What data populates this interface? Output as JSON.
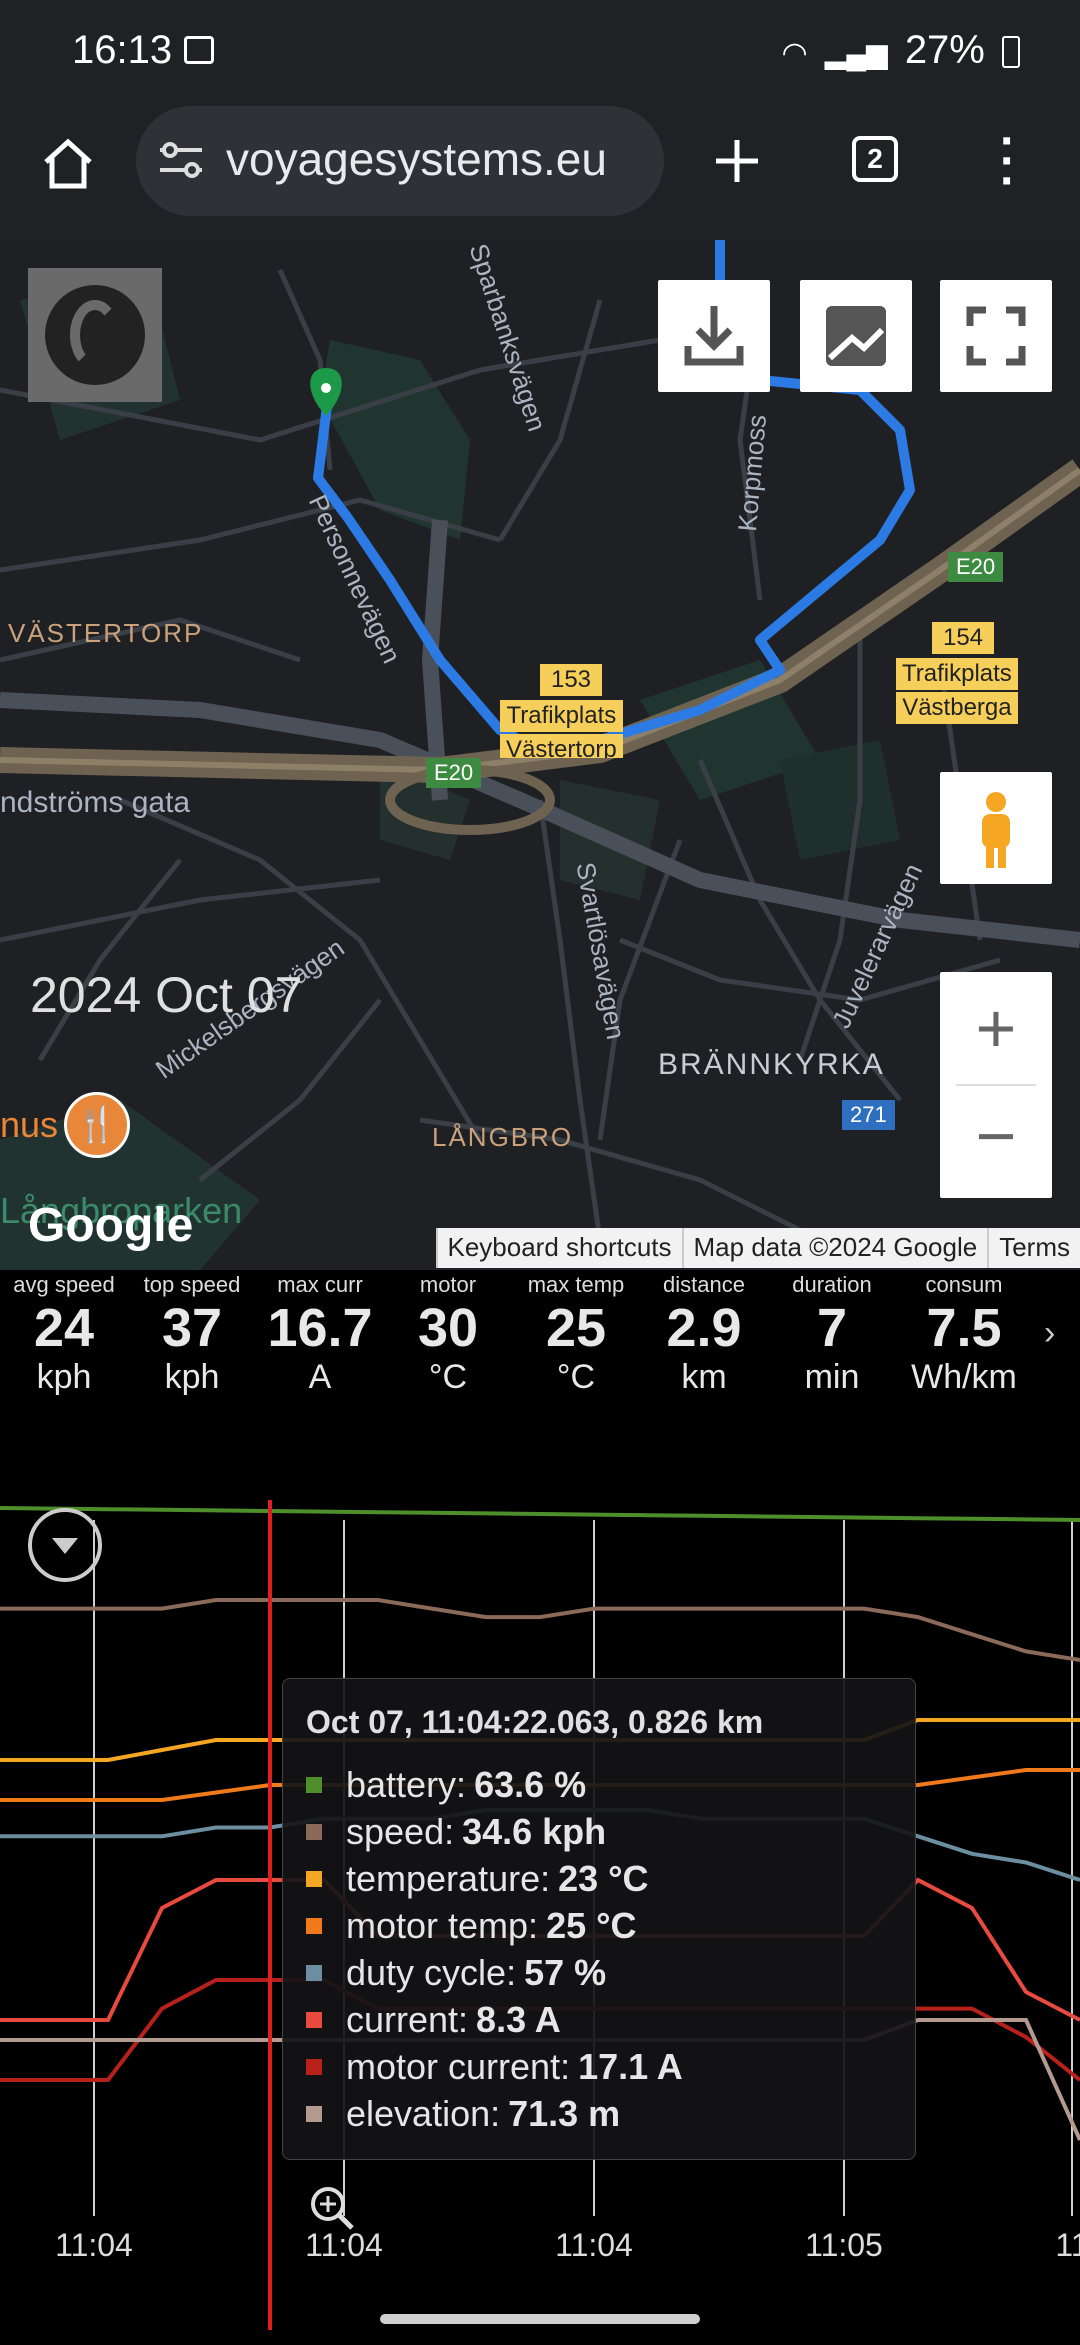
{
  "status": {
    "time": "16:13",
    "battery": "27%"
  },
  "browser": {
    "url": "voyagesystems.eu",
    "tab_count": "2"
  },
  "map": {
    "date": "2024 Oct 07",
    "google": "Google",
    "labels": {
      "vastertorp": "VÄSTERTORP",
      "brannkyrka": "BRÄNNKYRKA",
      "langbro": "LÅNGBRO",
      "langbroparken": "Långbroparken",
      "ndstroms": "ndströms gata",
      "mickelsberg": "Mickelsbergsvägen",
      "svartlosa": "Svartlösavägen",
      "juvelerar": "Juvelerarvägen",
      "korpmoss": "Korpmoss",
      "harbanks": "Sparbanksvägen",
      "peterson": "Personnevägen",
      "nus": "nus"
    },
    "badges": {
      "e20_a": "E20",
      "e20_b": "E20",
      "r271": "271"
    },
    "tags": {
      "t153_num": "153",
      "t153_name": "Trafikplats",
      "t153_sub": "Västertorp",
      "t154_num": "154",
      "t154_name": "Trafikplats",
      "t154_sub": "Västberga"
    },
    "attribution": {
      "shortcuts": "Keyboard shortcuts",
      "mapdata": "Map data ©2024 Google",
      "terms": "Terms"
    }
  },
  "stats": [
    {
      "label": "avg speed",
      "value": "24",
      "unit": "kph"
    },
    {
      "label": "top speed",
      "value": "37",
      "unit": "kph"
    },
    {
      "label": "max curr",
      "value": "16.7",
      "unit": "A"
    },
    {
      "label": "motor",
      "value": "30",
      "unit": "°C"
    },
    {
      "label": "max temp",
      "value": "25",
      "unit": "°C"
    },
    {
      "label": "distance",
      "value": "2.9",
      "unit": "km"
    },
    {
      "label": "duration",
      "value": "7",
      "unit": "min"
    },
    {
      "label": "consum",
      "value": "7.5",
      "unit": "Wh/km"
    }
  ],
  "tooltip": {
    "title": "Oct 07, 11:04:22.063, 0.826 km",
    "rows": [
      {
        "name": "battery",
        "value": "63.6 %",
        "color": "#4f8f2b"
      },
      {
        "name": "speed",
        "value": "34.6 kph",
        "color": "#8b6a5a"
      },
      {
        "name": "temperature",
        "value": "23 °C",
        "color": "#f5a623"
      },
      {
        "name": "motor temp",
        "value": "25 °C",
        "color": "#f07a1a"
      },
      {
        "name": "duty cycle",
        "value": "57 %",
        "color": "#6b8ea0"
      },
      {
        "name": "current",
        "value": "8.3 A",
        "color": "#e84a3f"
      },
      {
        "name": "motor current",
        "value": "17.1 A",
        "color": "#b8211b"
      },
      {
        "name": "elevation",
        "value": "71.3 m",
        "color": "#b49a8e"
      }
    ]
  },
  "chart_data": {
    "type": "line",
    "x_ticks": [
      "11:04",
      "11:04",
      "11:04",
      "11:05",
      "11"
    ],
    "series": [
      {
        "name": "battery",
        "color": "#4f8f2b",
        "values": [
          65,
          64.9,
          64.8,
          64.7,
          64.6,
          64.5,
          64.4,
          64.3,
          64.2,
          64.1,
          64.0,
          63.9,
          63.8,
          63.7,
          63.6,
          63.5,
          63.4,
          63.3,
          63.2,
          63.1,
          63.0
        ]
      },
      {
        "name": "speed",
        "color": "#8b6a5a",
        "values": [
          35,
          35,
          35,
          35,
          36,
          36,
          36,
          36,
          35,
          34,
          34,
          35,
          35,
          35,
          35,
          35,
          35,
          34,
          32,
          30,
          29
        ]
      },
      {
        "name": "temperature",
        "color": "#f5a623",
        "values": [
          22,
          22,
          22,
          22.5,
          23,
          23,
          23,
          23,
          23,
          23,
          23,
          23,
          23,
          23,
          23,
          23,
          23,
          24,
          24,
          24,
          24
        ]
      },
      {
        "name": "motor temp",
        "color": "#f07a1a",
        "values": [
          24,
          24,
          24,
          24,
          24.5,
          25,
          25,
          25,
          25,
          25,
          25,
          25,
          25,
          25,
          25,
          25,
          25,
          25,
          25.5,
          26,
          26
        ]
      },
      {
        "name": "duty cycle",
        "color": "#6b8ea0",
        "values": [
          55,
          55,
          55,
          55,
          56,
          56,
          57,
          57,
          57,
          58,
          58,
          58,
          58,
          57,
          57,
          57,
          57,
          55,
          53,
          52,
          50
        ]
      },
      {
        "name": "current",
        "color": "#e84a3f",
        "values": [
          2,
          2,
          2,
          10,
          12,
          12,
          12,
          8,
          8,
          8,
          8,
          8,
          8,
          8,
          8,
          8,
          8,
          12,
          10,
          4,
          2
        ]
      },
      {
        "name": "motor current",
        "color": "#b8211b",
        "values": [
          1,
          1,
          1,
          6,
          8,
          8,
          8,
          6,
          6,
          6,
          6,
          6,
          6,
          6,
          6,
          6,
          6,
          6,
          6,
          4,
          1
        ]
      },
      {
        "name": "elevation",
        "color": "#b49a8e",
        "values": [
          70,
          70,
          70,
          70,
          70,
          70,
          70,
          70,
          70,
          70,
          70,
          70,
          70,
          70,
          70,
          70,
          70,
          72,
          72,
          72,
          60
        ]
      }
    ]
  }
}
